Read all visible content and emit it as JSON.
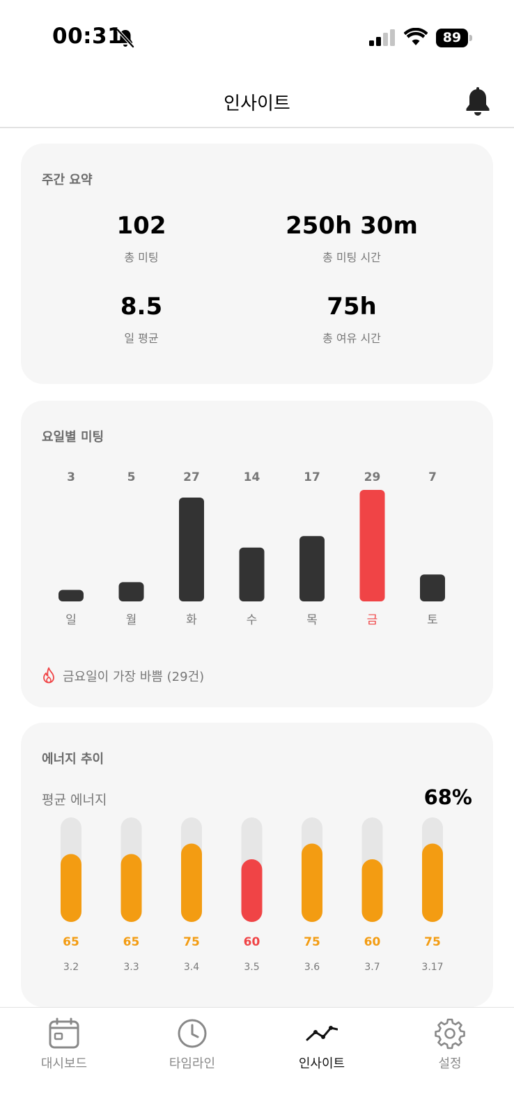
{
  "status_bar": {
    "time": "00:31",
    "battery": "89"
  },
  "header": {
    "title": "인사이트"
  },
  "weekly_summary": {
    "title": "주간 요약",
    "stats": [
      {
        "value": "102",
        "label": "총 미팅"
      },
      {
        "value": "250h 30m",
        "label": "총 미팅 시간"
      },
      {
        "value": "8.5",
        "label": "일 평균"
      },
      {
        "value": "75h",
        "label": "총 여유 시간"
      }
    ]
  },
  "weekday_meetings": {
    "title": "요일별 미팅",
    "busiest_note": "금요일이 가장 바쁨 (29건)"
  },
  "energy_trend": {
    "title": "에너지 추이",
    "average_label": "평균 에너지",
    "average_value": "68%"
  },
  "chart_data": [
    {
      "type": "bar",
      "categories": [
        "일",
        "월",
        "화",
        "수",
        "목",
        "금",
        "토"
      ],
      "values": [
        3,
        5,
        27,
        14,
        17,
        29,
        7
      ],
      "highlight_index": 5,
      "ylim": [
        0,
        29
      ],
      "grid": false
    },
    {
      "type": "bar",
      "categories": [
        "3.2",
        "3.3",
        "3.4",
        "3.5",
        "3.6",
        "3.7",
        "3.17"
      ],
      "values": [
        65,
        65,
        75,
        60,
        75,
        60,
        75
      ],
      "highlight_index": 3,
      "ylim": [
        0,
        100
      ],
      "grid": false
    }
  ],
  "colors": {
    "bar_default": "#333333",
    "bar_highlight": "#f04446",
    "energy_fill": "#f39c12",
    "energy_low": "#f04446",
    "track": "#e6e6e6",
    "card_bg": "#f6f6f6"
  },
  "tab_bar": {
    "tabs": [
      {
        "label": "대시보드",
        "icon": "calendar-icon"
      },
      {
        "label": "타임라인",
        "icon": "clock-icon"
      },
      {
        "label": "인사이트",
        "icon": "trend-line-icon"
      },
      {
        "label": "설정",
        "icon": "gear-icon"
      }
    ],
    "active_index": 2
  }
}
